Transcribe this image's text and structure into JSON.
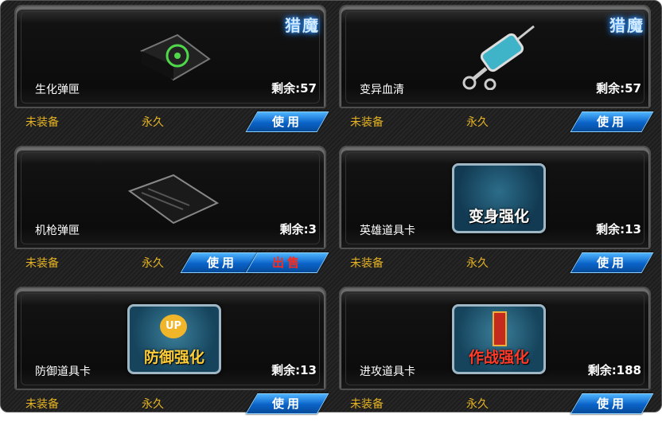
{
  "items": [
    {
      "name": "生化弹匣",
      "qty": "剩余:57",
      "status": "未装备",
      "duration": "永久",
      "use": "使用",
      "tag": "猎魔",
      "icon": "biohazard-magazine-icon"
    },
    {
      "name": "变异血清",
      "qty": "剩余:57",
      "status": "未装备",
      "duration": "永久",
      "use": "使用",
      "tag": "猎魔",
      "icon": "serum-syringe-icon"
    },
    {
      "name": "机枪弹匣",
      "qty": "剩余:3",
      "status": "未装备",
      "duration": "永久",
      "use": "使用",
      "sell": "出售",
      "icon": "machine-gun-magazine-icon"
    },
    {
      "name": "英雄道具卡",
      "qty": "剩余:13",
      "status": "未装备",
      "duration": "永久",
      "use": "使用",
      "card_caption": "变身强化",
      "icon": "hero-card-icon"
    },
    {
      "name": "防御道具卡",
      "qty": "剩余:13",
      "status": "未装备",
      "duration": "永久",
      "use": "使用",
      "card_caption": "防御强化",
      "card_badge": "UP",
      "icon": "defense-card-icon"
    },
    {
      "name": "进攻道具卡",
      "qty": "剩余:188",
      "status": "未装备",
      "duration": "永久",
      "use": "使用",
      "card_caption": "作战强化",
      "icon": "attack-card-icon"
    }
  ],
  "colors": {
    "accent": "#e5b323",
    "button": "#0a63c8",
    "sell_text": "#ff2a1a"
  }
}
